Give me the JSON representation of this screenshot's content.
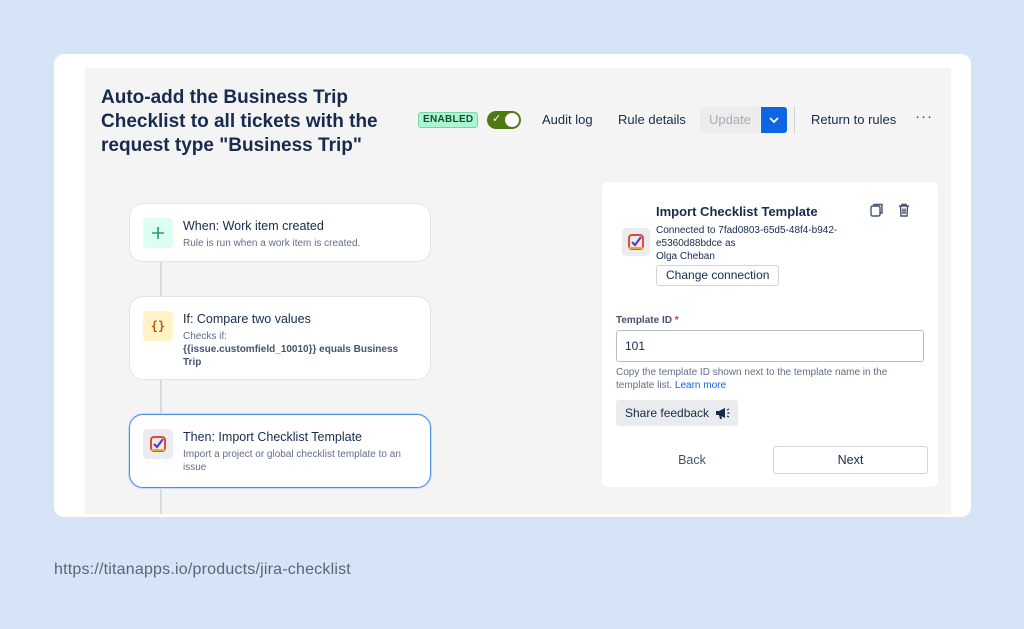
{
  "header": {
    "title": "Auto-add the Business Trip Checklist to all tickets with the request type \"Business Trip\"",
    "status_badge": "ENABLED",
    "toggle_on": true,
    "audit_log": "Audit log",
    "rule_details": "Rule details",
    "update": "Update",
    "return_to_rules": "Return to rules",
    "more": "···"
  },
  "flow": {
    "trigger": {
      "title": "When: Work item created",
      "subtitle": "Rule is run when a work item is created.",
      "icon": "plus-icon"
    },
    "condition": {
      "title": "If: Compare two values",
      "subtitle_prefix": "Checks if:",
      "subtitle_detail": "{{issue.customfield_10010}} equals Business Trip",
      "icon": "braces-icon"
    },
    "action": {
      "title": "Then: Import Checklist Template",
      "subtitle": "Import a project or global checklist template to an issue",
      "icon": "checklist-app-icon"
    }
  },
  "panel": {
    "title": "Import Checklist Template",
    "connection": "Connected to 7fad0803-65d5-48f4-b942-e5360d88bdce as",
    "user": "Olga Cheban",
    "change_connection": "Change connection",
    "template_label": "Template ID",
    "template_value": "101",
    "help_text": "Copy the template ID shown next to the template name in the template list.",
    "learn_more": "Learn more",
    "share_feedback": "Share feedback",
    "back": "Back",
    "next": "Next"
  },
  "footer": {
    "url": "https://titanapps.io/products/jira-checklist"
  },
  "colors": {
    "accent": "#0c66e4",
    "toggle": "#4e7a14",
    "badge_bg": "#abf5d1",
    "page_bg": "#d6e4f8"
  }
}
